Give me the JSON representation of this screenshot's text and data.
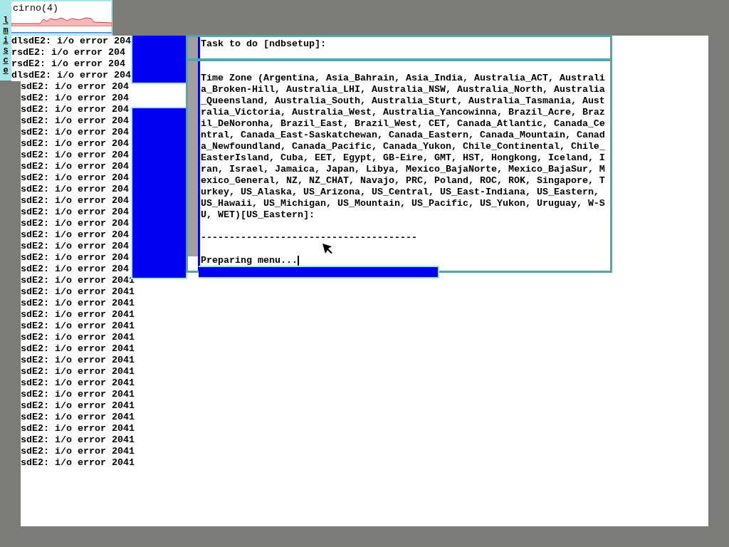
{
  "status_monitor": {
    "title": "cirno(4)",
    "labels": [
      "l",
      "m",
      "i",
      "s",
      "c",
      "e"
    ]
  },
  "console": {
    "overlapped_lines": [
      "dlsdE2: i/o error 204",
      "rsdE2: i/o error 204",
      "rsdE2: i/o error 204",
      "dlsdE2: i/o error 204"
    ],
    "lines": [
      "sdE2: i/o error 204",
      "sdE2: i/o error 204",
      "sdE2: i/o error 204",
      "sdE2: i/o error 204",
      "sdE2: i/o error 204",
      "sdE2: i/o error 204",
      "sdE2: i/o error 204",
      "sdE2: i/o error 204",
      "sdE2: i/o error 204",
      "sdE2: i/o error 204",
      "sdE2: i/o error 204",
      "sdE2: i/o error 204",
      "sdE2: i/o error 204",
      "sdE2: i/o error 204",
      "sdE2: i/o error 204",
      "sdE2: i/o error 204",
      "sdE2: i/o error 204",
      "sdE2: i/o error 2041",
      "sdE2: i/o error 2041",
      "sdE2: i/o error 2041",
      "sdE2: i/o error 2041",
      "sdE2: i/o error 2041",
      "sdE2: i/o error 2041",
      "sdE2: i/o error 2041",
      "sdE2: i/o error 2041",
      "sdE2: i/o error 2041",
      "sdE2: i/o error 2041",
      "sdE2: i/o error 2041",
      "sdE2: i/o error 2041",
      "sdE2: i/o error 2041",
      "sdE2: i/o error 2041",
      "sdE2: i/o error 2041",
      "sdE2: i/o error 2041",
      "sdE2: i/o error 2041"
    ]
  },
  "setup_window": {
    "task_prompt": "Task to do [ndbsetup]:",
    "prompt_lines": [
      "Time Zone (Argentina, Asia_Bahrain, Asia_India, Australia_ACT, Australi",
      "a_Broken-Hill, Australia_LHI, Australia_NSW, Australia_North, Australia",
      "_Queensland, Australia_South, Australia_Sturt, Australia_Tasmania, Aust",
      "ralia_Victoria, Australia_West, Australia_Yancowinna, Brazil_Acre, Braz",
      "il_DeNoronha, Brazil_East, Brazil_West, CET, Canada_Atlantic, Canada_Ce",
      "ntral, Canada_East-Saskatchewan, Canada_Eastern, Canada_Mountain, Canad",
      "a_Newfoundland, Canada_Pacific, Canada_Yukon, Chile_Continental, Chile_",
      "EasterIsland, Cuba, EET, Egypt, GB-Eire, GMT, HST, Hongkong, Iceland, I",
      "ran, Israel, Jamaica, Japan, Libya, Mexico_BajaNorte, Mexico_BajaSur, M",
      "exico_General, NZ, NZ_CHAT, Navajo, PRC, Poland, ROC, ROK, Singapore, T",
      "urkey, US_Alaska, US_Arizona, US_Central, US_East-Indiana, US_Eastern, ",
      "US_Hawaii, US_Michigan, US_Mountain, US_Pacific, US_Yukon, Uruguay, W-S",
      "U, WET)[US_Eastern]:"
    ],
    "separator": "--------------------------------------",
    "status": "Preparing menu..."
  }
}
